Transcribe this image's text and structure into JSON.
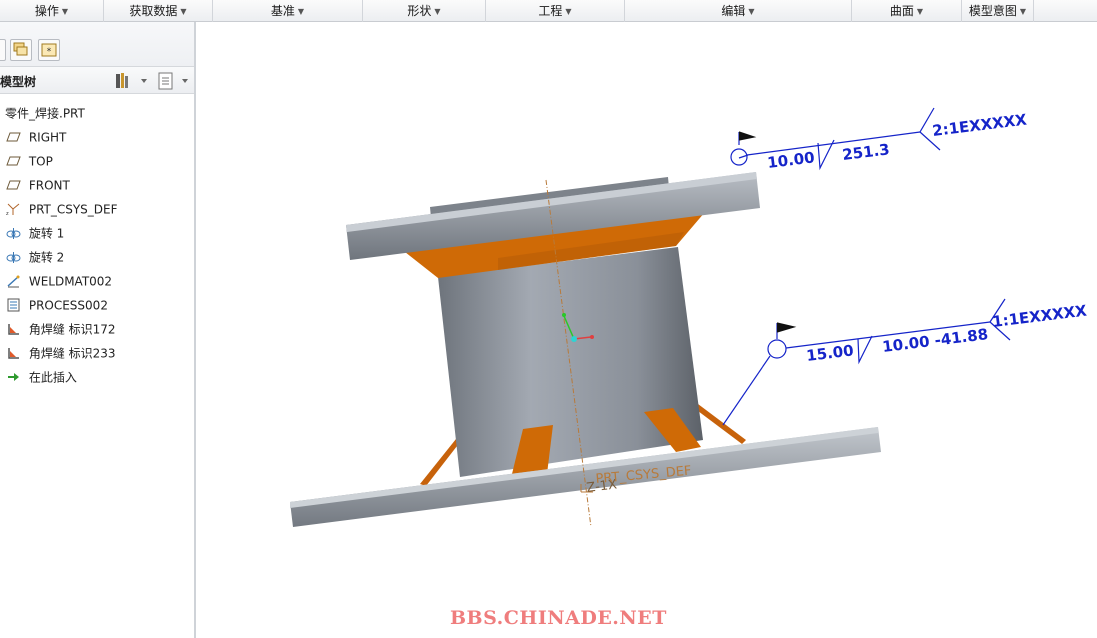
{
  "menubar": {
    "items": [
      {
        "label": "操作"
      },
      {
        "label": "获取数据"
      },
      {
        "label": "基准"
      },
      {
        "label": "形状"
      },
      {
        "label": "工程"
      },
      {
        "label": "编辑"
      },
      {
        "label": "曲面"
      },
      {
        "label": "模型意图"
      }
    ]
  },
  "left_panel": {
    "tab_icons": [
      "layers-icon",
      "star-doc-icon"
    ],
    "header": {
      "title": "模型树",
      "tool_icons": [
        "settings-icon",
        "tree-filter-icon"
      ]
    },
    "tree": {
      "root": "零件_焊接.PRT",
      "items": [
        {
          "label": "RIGHT",
          "icon": "datum-plane-icon"
        },
        {
          "label": "TOP",
          "icon": "datum-plane-icon"
        },
        {
          "label": "FRONT",
          "icon": "datum-plane-icon"
        },
        {
          "label": "PRT_CSYS_DEF",
          "icon": "csys-icon"
        },
        {
          "label": "旋转 1",
          "icon": "revolve-icon"
        },
        {
          "label": "旋转 2",
          "icon": "revolve-icon"
        },
        {
          "label": "WELDMAT002",
          "icon": "weld-material-icon"
        },
        {
          "label": "PROCESS002",
          "icon": "process-icon"
        },
        {
          "label": "角焊缝 标识172",
          "icon": "fillet-weld-icon"
        },
        {
          "label": "角焊缝 标识233",
          "icon": "fillet-weld-icon"
        },
        {
          "label": "在此插入",
          "icon": "insert-here-arrow-icon"
        }
      ]
    }
  },
  "viewport": {
    "csys_label": "PRT_CSYS_DEF",
    "csys_axes_label": "Z-1X",
    "weld_symbol_top": {
      "size": "10.00",
      "length": "251.3",
      "id": "2:1EXXXXX"
    },
    "weld_symbol_bottom": {
      "size": "15.00",
      "length_pitch": "10.00 -41.88",
      "id": "1:1EXXXXX"
    },
    "watermark": "BBS.CHINADE.NET",
    "colors": {
      "annotation": "#1524c9",
      "part_gray": "#8a9099",
      "weld_orange": "#d66f00",
      "datum": "#b87a3a"
    }
  }
}
